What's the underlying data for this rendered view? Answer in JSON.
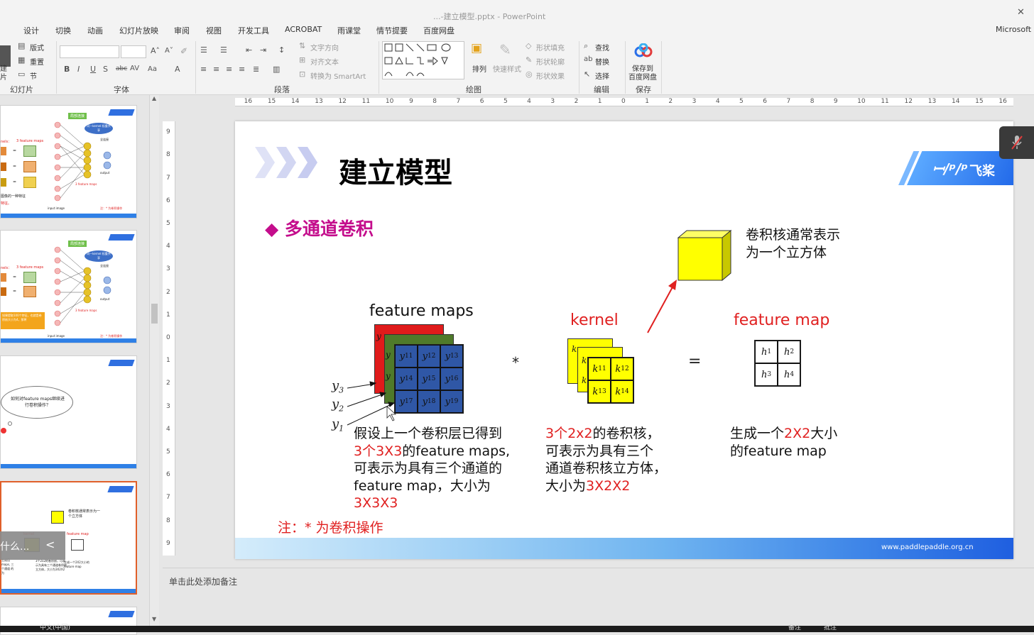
{
  "window": {
    "title": "...-建立模型.pptx - PowerPoint"
  },
  "menu_tabs": [
    "设计",
    "切换",
    "动画",
    "幻灯片放映",
    "审阅",
    "视图",
    "开发工具",
    "ACROBAT",
    "雨课堂",
    "情节提要",
    "百度网盘"
  ],
  "account": "Microsoft",
  "ribbon": {
    "groups": {
      "slides": "幻灯片",
      "font": "字体",
      "paragraph": "段落",
      "drawing": "绘图",
      "editing": "编辑",
      "save": "保存"
    },
    "slides": {
      "layout": "版式",
      "reset": "重置",
      "section": "节",
      "new_l1": "建",
      "new_l2": "片"
    },
    "paragraph": {
      "text_dir": "文字方向",
      "align_text": "对齐文本",
      "smartart": "转换为 SmartArt"
    },
    "drawing": {
      "arrange": "排列",
      "quick_styles": "快速样式",
      "fill": "形状填充",
      "outline": "形状轮廓",
      "effects": "形状效果"
    },
    "editing": {
      "find": "查找",
      "replace": "替换",
      "select": "选择"
    },
    "save": {
      "l1": "保存到",
      "l2": "百度网盘"
    }
  },
  "ruler": {
    "h_ticks": [
      "16",
      "15",
      "14",
      "13",
      "12",
      "11",
      "10",
      "9",
      "8",
      "7",
      "6",
      "5",
      "4",
      "3",
      "2",
      "1",
      "0",
      "1",
      "2",
      "3",
      "4",
      "5",
      "6",
      "7",
      "8",
      "9",
      "10",
      "11",
      "12",
      "13",
      "14",
      "15",
      "16"
    ],
    "v_ticks": [
      "9",
      "8",
      "7",
      "6",
      "5",
      "4",
      "3",
      "2",
      "1",
      "0",
      "1",
      "2",
      "3",
      "4",
      "5",
      "6",
      "7",
      "8",
      "9"
    ]
  },
  "thumbnails": {
    "t1": {
      "tag": "局部连接",
      "bubble": "同一kernel 权重共享",
      "full": "全连接",
      "out": "output",
      "maps": "3 feature maps",
      "kernels": "nels：",
      "sub": "3 feature maps",
      "input": "input image",
      "note": "注：* 为卷积操作",
      "text1": "图像的一种特征",
      "text2": "特征。"
    },
    "t2": {
      "tag": "局部连接",
      "bubble": "同一kernel 权重共享",
      "full": "全连接",
      "out": "output",
      "maps": "3 feature maps",
      "kernels": "nels：",
      "sub": "3 feature maps",
      "input": "input image",
      "note": "注：* 为卷积操作",
      "yellow": "如果提取100个特征，也就是卷积核大小为4，那将"
    },
    "t3": {
      "cloud": "如何对feature maps继续进行卷积操作？"
    },
    "t4": {
      "cube_text": "卷积核通常表示为一个立方体",
      "kernel": "kernel",
      "fmap": "feature map",
      "c1": "3个2x2的卷积核，可表示为具有三个通道卷积核立方体，大小为3X2X2",
      "c3": "生成一个2X2大小的feature map",
      "left": "生成用 maps, 三个通道 的 为",
      "ovl": "什么...",
      "arrow": "<"
    }
  },
  "slide": {
    "title": "建立模型",
    "logo": "飞桨",
    "subtitle": "◆ 多通道卷积",
    "cube_caption": [
      "卷积核通常表示",
      "为一个立方体"
    ],
    "fm_label": "feature maps",
    "kernel_label": "kernel",
    "out_label": "feature map",
    "star": "*",
    "equals": "=",
    "y_labels": [
      "y",
      "3",
      "y",
      "2",
      "y",
      "1"
    ],
    "grid_blue": [
      [
        "y",
        "11"
      ],
      [
        "y",
        "12"
      ],
      [
        "y",
        "13"
      ],
      [
        "y",
        "14"
      ],
      [
        "y",
        "15"
      ],
      [
        "y",
        "16"
      ],
      [
        "y",
        "17"
      ],
      [
        "y",
        "18"
      ],
      [
        "y",
        "19"
      ]
    ],
    "kernel_cells": [
      [
        "k",
        "11"
      ],
      [
        "k",
        "12"
      ],
      [
        "k",
        "13"
      ],
      [
        "k",
        "14"
      ]
    ],
    "k_back": "k",
    "y_peek": "y",
    "out_cells": [
      [
        "h",
        "1"
      ],
      [
        "h",
        "2"
      ],
      [
        "h",
        "3"
      ],
      [
        "h",
        "4"
      ]
    ],
    "desc1": {
      "a": "假设上一个卷积层已得到",
      "b_red": "3个3X3",
      "b": "的feature maps,",
      "c": "可表示为具有三个通道的",
      "d": "feature map，大小为",
      "e_red": "3X3X3"
    },
    "desc2": {
      "a_red": "3个2x2",
      "a": "的卷积核，",
      "b": "可表示为具有三个",
      "c": "通道卷积核立方体，",
      "d": "大小为",
      "d_red": "3X2X2"
    },
    "desc3": {
      "a": "生成一个",
      "a_red": "2X2",
      "a2": "大小",
      "b": "的feature map"
    },
    "note": "注：* 为卷积操作",
    "url": "www.paddlepaddle.org.cn"
  },
  "notes_placeholder": "单击此处添加备注",
  "status": {
    "lang": "中文(中国)",
    "notes": "备注",
    "comments": "批注"
  },
  "colors": {
    "red": "#e02020",
    "magenta": "#c40d8c",
    "blue": "#2f57a6",
    "green": "#4f7a2a",
    "layer_red": "#e01b1b",
    "yellow": "#ffff00",
    "accent": "#2f80e6"
  }
}
